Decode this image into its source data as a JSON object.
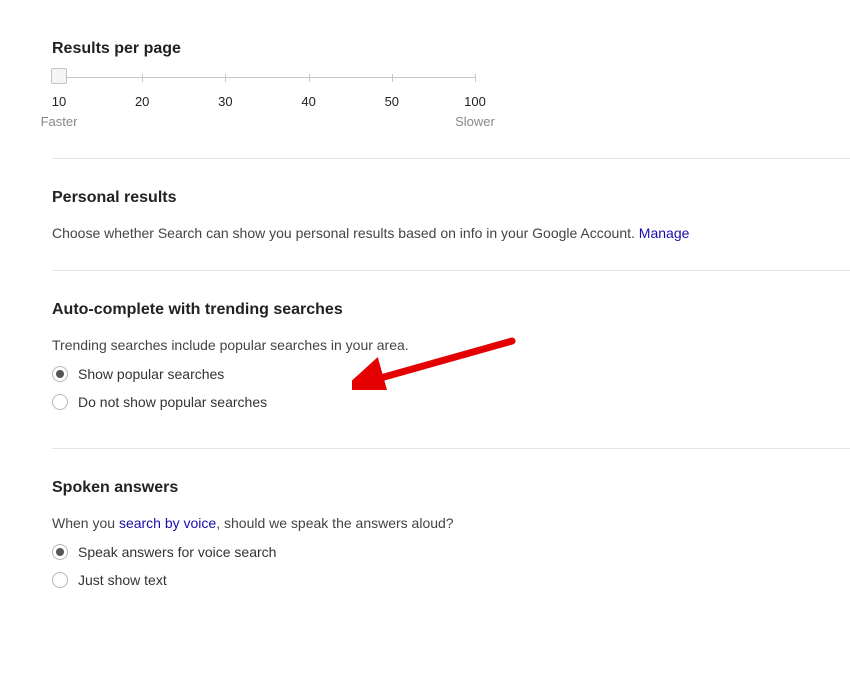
{
  "resultsPerPage": {
    "heading": "Results per page",
    "ticks": [
      "10",
      "20",
      "30",
      "40",
      "50",
      "100"
    ],
    "fasterLabel": "Faster",
    "slowerLabel": "Slower",
    "selectedIndex": 0
  },
  "personalResults": {
    "heading": "Personal results",
    "description": "Choose whether Search can show you personal results based on info in your Google Account. ",
    "manageLabel": "Manage"
  },
  "autoComplete": {
    "heading": "Auto-complete with trending searches",
    "description": "Trending searches include popular searches in your area.",
    "options": [
      {
        "label": "Show popular searches",
        "checked": true
      },
      {
        "label": "Do not show popular searches",
        "checked": false
      }
    ]
  },
  "spokenAnswers": {
    "heading": "Spoken answers",
    "descriptionPrefix": "When you ",
    "linkText": "search by voice",
    "descriptionSuffix": ", should we speak the answers aloud?",
    "options": [
      {
        "label": "Speak answers for voice search",
        "checked": true
      },
      {
        "label": "Just show text",
        "checked": false
      }
    ]
  }
}
